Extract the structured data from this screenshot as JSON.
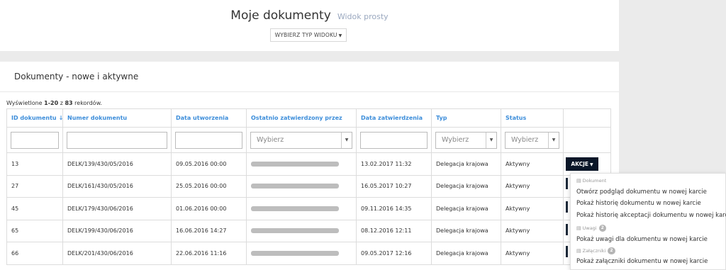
{
  "header": {
    "title": "Moje dokumenty",
    "subtitle": "Widok prosty",
    "view_button": "WYBIERZ TYP WIDOKU"
  },
  "panel": {
    "title": "Dokumenty - nowe i aktywne",
    "records": {
      "prefix": "Wyświetlone ",
      "range": "1-20",
      "middle": " z ",
      "total": "83",
      "suffix": " rekordów."
    }
  },
  "table": {
    "columns": [
      "ID dokumentu",
      "Numer dokumentu",
      "Data utworzenia",
      "Ostatnio zatwierdzony przez",
      "Data zatwierdzenia",
      "Typ",
      "Status"
    ],
    "select_placeholder": "Wybierz",
    "rows": [
      {
        "id": "13",
        "number": "DELK/139/430/05/2016",
        "created": "09.05.2016 00:00",
        "approved": "13.02.2017 11:32",
        "type": "Delegacja krajowa",
        "status": "Aktywny"
      },
      {
        "id": "27",
        "number": "DELK/161/430/05/2016",
        "created": "25.05.2016 00:00",
        "approved": "16.05.2017 10:27",
        "type": "Delegacja krajowa",
        "status": "Aktywny"
      },
      {
        "id": "45",
        "number": "DELK/179/430/06/2016",
        "created": "01.06.2016 00:00",
        "approved": "09.11.2016 14:35",
        "type": "Delegacja krajowa",
        "status": "Aktywny"
      },
      {
        "id": "65",
        "number": "DELK/199/430/06/2016",
        "created": "16.06.2016 14:27",
        "approved": "08.12.2016 12:11",
        "type": "Delegacja krajowa",
        "status": "Aktywny"
      },
      {
        "id": "66",
        "number": "DELK/201/430/06/2016",
        "created": "22.06.2016 11:16",
        "approved": "09.05.2017 12:16",
        "type": "Delegacja krajowa",
        "status": "Aktywny"
      }
    ]
  },
  "actions": {
    "button": "AKCJE",
    "menu": {
      "dokument_header": "Dokument",
      "item1": "Otwórz podgląd dokumentu w nowej karcie",
      "item2": "Pokaż historię dokumentu w nowej karcie",
      "item3": "Pokaż historię akceptacji dokumentu w nowej karcie",
      "uwagi_header": "Uwagi",
      "uwagi_count": "2",
      "item4": "Pokaż uwagi dla dokumentu w nowej karcie",
      "zalaczniki_header": "Załączniki",
      "zalaczniki_count": "2",
      "item5": "Pokaż załączniki dokumentu w nowej karcie"
    }
  },
  "icons": {
    "sort": "sort-numeric-icon",
    "caret": "caret-down-icon",
    "file": "file-icon"
  },
  "colors": {
    "link_blue": "#3c8dda",
    "akcje_bg": "#0a1628",
    "muted": "#9aa8bf"
  }
}
